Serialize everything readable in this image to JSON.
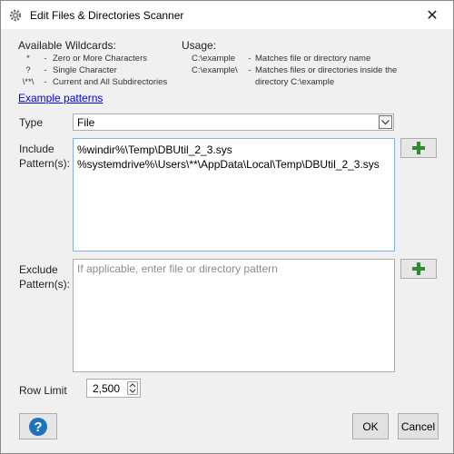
{
  "window": {
    "title": "Edit Files & Directories Scanner",
    "close_glyph": "✕"
  },
  "wildcards": {
    "title": "Available Wildcards:",
    "rows": [
      {
        "symbol": "*",
        "dash": "-",
        "desc": "Zero or More Characters"
      },
      {
        "symbol": "?",
        "dash": "-",
        "desc": "Single Character"
      },
      {
        "symbol": "\\**\\",
        "dash": "-",
        "desc": "Current and All Subdirectories"
      }
    ]
  },
  "usage": {
    "title": "Usage:",
    "rows": [
      {
        "path": "C:\\example",
        "dash": "-",
        "desc": "Matches file or directory name"
      },
      {
        "path": "C:\\example\\",
        "dash": "-",
        "desc": "Matches files or directories inside the"
      },
      {
        "path": "",
        "dash": "",
        "desc": "directory C:\\example"
      }
    ]
  },
  "example_link": "Example patterns",
  "type": {
    "label": "Type",
    "value": "File",
    "icon": "chevron-down-icon"
  },
  "include": {
    "label_line1": "Include",
    "label_line2": "Pattern(s):",
    "lines": [
      "%windir%\\Temp\\DBUtil_2_3.sys",
      "%systemdrive%\\Users\\**\\AppData\\Local\\Temp\\DBUtil_2_3.sys"
    ],
    "add_icon": "plus-icon"
  },
  "exclude": {
    "label_line1": "Exclude",
    "label_line2": "Pattern(s):",
    "placeholder": "If applicable, enter file or directory pattern",
    "add_icon": "plus-icon"
  },
  "row_limit": {
    "label": "Row Limit",
    "value": "2,500"
  },
  "buttons": {
    "help_icon": "question-icon",
    "ok": "OK",
    "cancel": "Cancel"
  },
  "colors": {
    "accent_blue": "#1e73be",
    "plus_green": "#2e8b2e",
    "link": "#0000ee"
  }
}
